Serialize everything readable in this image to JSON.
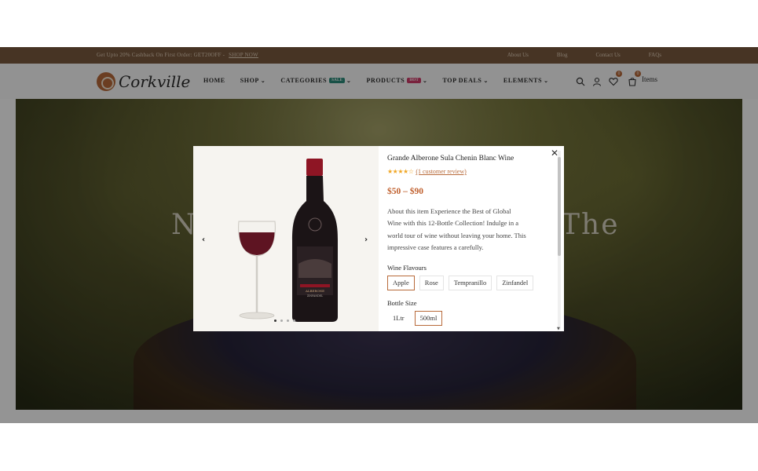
{
  "topbar": {
    "promo": "Get Upto 20% Cashback On First Order: GET20OFF -",
    "shop_now": "SHOP NOW",
    "links": [
      "About Us",
      "Blog",
      "Contact Us",
      "FAQs"
    ]
  },
  "header": {
    "logo": "Corkville",
    "nav": [
      {
        "label": "HOME",
        "chevron": false,
        "badge": null
      },
      {
        "label": "SHOP",
        "chevron": true,
        "badge": null
      },
      {
        "label": "CATEGORIES",
        "chevron": true,
        "badge": "SALE"
      },
      {
        "label": "PRODUCTS",
        "chevron": true,
        "badge": "HOT"
      },
      {
        "label": "TOP DEALS",
        "chevron": true,
        "badge": null
      },
      {
        "label": "ELEMENTS",
        "chevron": true,
        "badge": null
      }
    ],
    "wishlist_count": "0",
    "cart_count": "0",
    "cart_label": "Items"
  },
  "hero": {
    "title_left": "N",
    "title_right": "The"
  },
  "modal": {
    "product_title": "Grande Alberone Sula Chenin Blanc Wine",
    "stars": "★★★★☆",
    "rating_value": 4,
    "review_link": "(1 customer review)",
    "price": "$50 – $90",
    "description": [
      "About this item Experience the Best of Global",
      "Wine with this 12-Bottle Collection! Indulge in a",
      "world tour of wine without leaving your home. This",
      "impressive case features a carefully."
    ],
    "flavours_label": "Wine Flavours",
    "flavours": [
      "Apple",
      "Rose",
      "Tempranillo",
      "Zinfandel"
    ],
    "flavour_selected": "Apple",
    "size_label": "Bottle Size",
    "sizes": [
      "1Ltr",
      "500ml"
    ],
    "size_selected": "500ml",
    "close_icon": "close-icon",
    "gallery_slides": 4,
    "gallery_active": 1,
    "bottle_label": "ALBERONE",
    "bottle_sublabel": "ZINFANDEL",
    "colors": {
      "accent": "#b86a3a",
      "price": "#c0602e",
      "star": "#f0a623",
      "topbar": "#7a5a3f"
    }
  }
}
